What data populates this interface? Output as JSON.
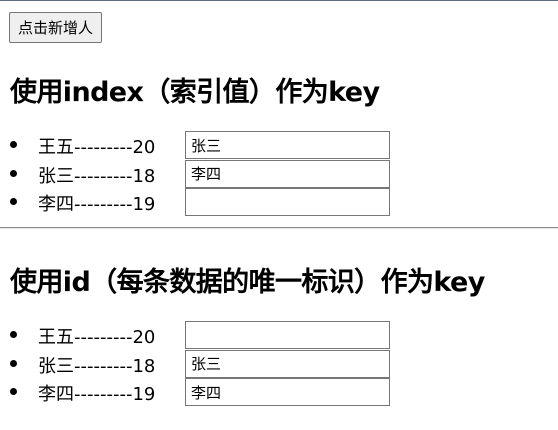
{
  "add_button_label": "点击新增人",
  "sections": [
    {
      "title": "使用index（索引值）作为key",
      "items": [
        {
          "text": "王五---------20",
          "input_value": "张三"
        },
        {
          "text": "张三---------18",
          "input_value": "李四"
        },
        {
          "text": "李四---------19",
          "input_value": ""
        }
      ]
    },
    {
      "title": "使用id（每条数据的唯一标识）作为key",
      "items": [
        {
          "text": "王五---------20",
          "input_value": ""
        },
        {
          "text": "张三---------18",
          "input_value": "张三"
        },
        {
          "text": "李四---------19",
          "input_value": "李四"
        }
      ]
    }
  ]
}
